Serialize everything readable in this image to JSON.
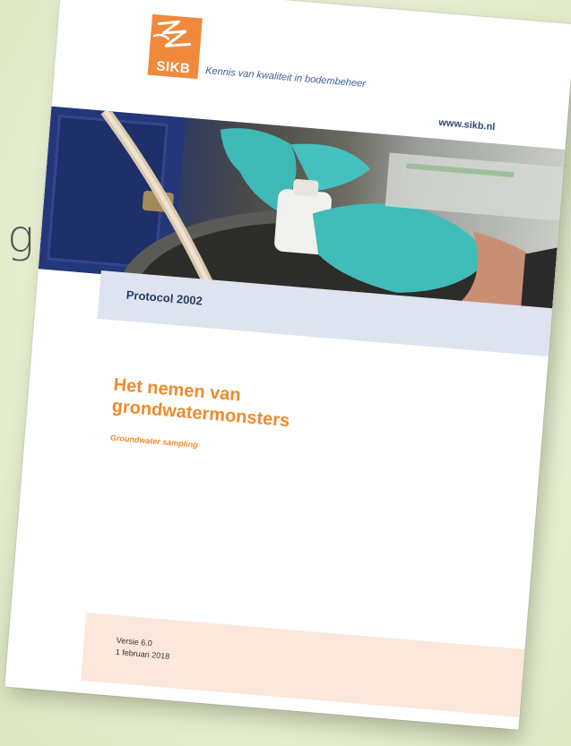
{
  "background": {
    "fragment_text": "g",
    "colors": {
      "center": "#f3f6e6",
      "edge": "#dbe6c2"
    }
  },
  "document": {
    "logo": {
      "text": "SIKB",
      "color": "#ef8a3d"
    },
    "tagline": "Kennis van kwaliteit in bodembeheer",
    "url": "www.sikb.nl",
    "photo": {
      "description_icon": "photo-sampling-icon"
    },
    "protocol_label": "Protocol 2002",
    "title_line1": "Het nemen van",
    "title_line2": "grondwatermonsters",
    "subtitle": "Groundwater sampling",
    "version": "Versie 6.0",
    "date": "1 februari 2018",
    "colors": {
      "accent_orange": "#ef8a2c",
      "band_blue": "#dde4ef",
      "band_peach": "#fbe7db",
      "text_blue": "#2a3a66"
    }
  }
}
